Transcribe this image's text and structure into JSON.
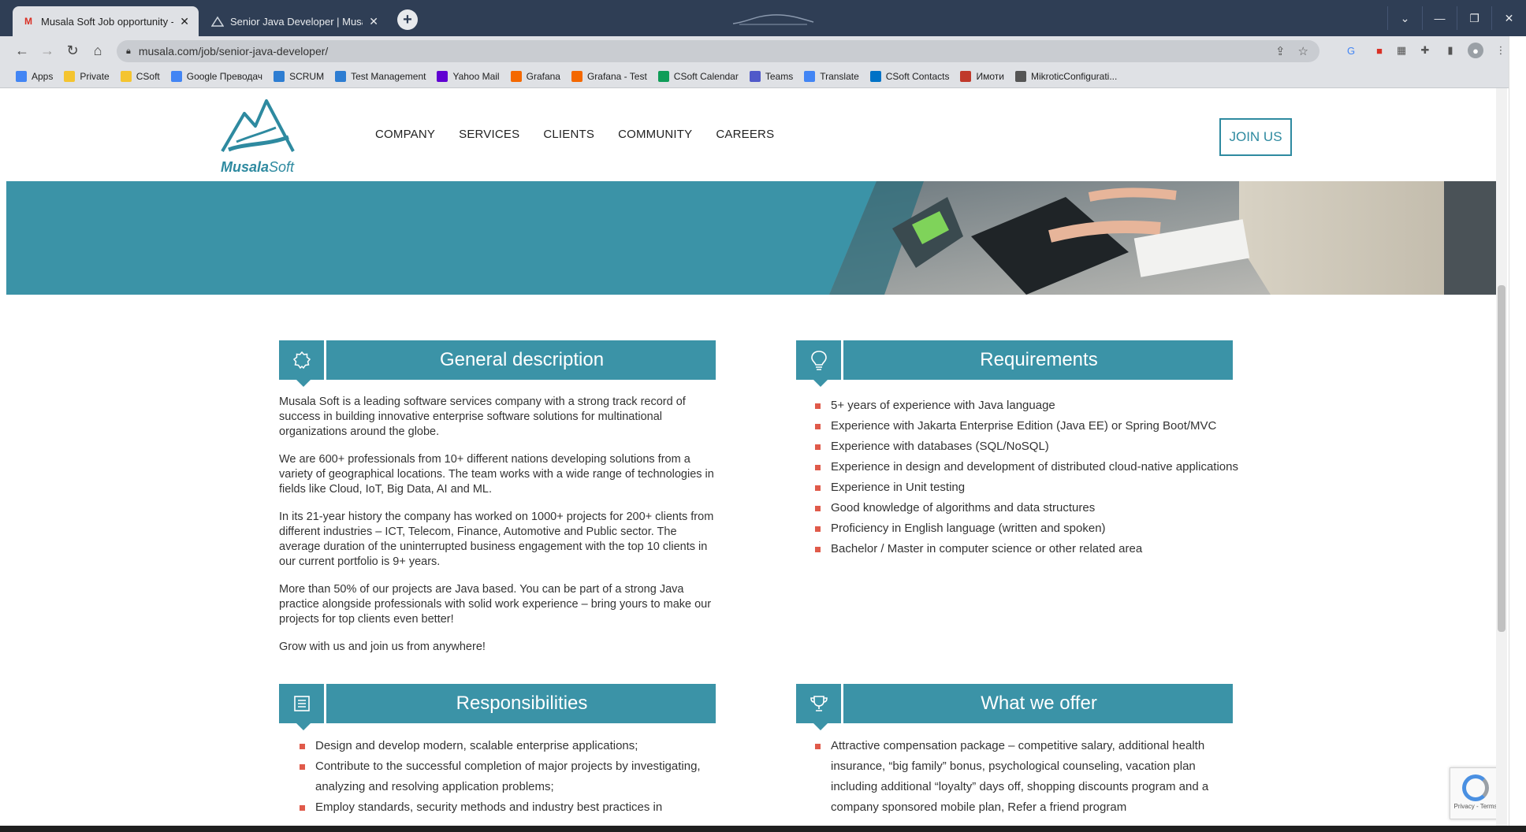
{
  "browser": {
    "tabs": [
      {
        "title": "Musala Soft Job opportunity - Au",
        "active": true
      },
      {
        "title": "Senior Java Developer | Musala S",
        "active": false
      }
    ],
    "new_tab_label": "+",
    "address": "musala.com/job/senior-java-developer/",
    "window_controls": {
      "collapse": "⌄",
      "minimize": "—",
      "restore": "❐",
      "close": "✕"
    }
  },
  "bookmarks": [
    {
      "label": "Apps",
      "color": "#4285f4"
    },
    {
      "label": "Private",
      "color": "#f4c430"
    },
    {
      "label": "CSoft",
      "color": "#f4c430"
    },
    {
      "label": "Google Преводач",
      "color": "#4285f4"
    },
    {
      "label": "SCRUM",
      "color": "#2d7dd2"
    },
    {
      "label": "Test Management",
      "color": "#2d7dd2"
    },
    {
      "label": "Yahoo Mail",
      "color": "#6001d2"
    },
    {
      "label": "Grafana",
      "color": "#f46800"
    },
    {
      "label": "Grafana - Test",
      "color": "#f46800"
    },
    {
      "label": "CSoft Calendar",
      "color": "#0f9d58"
    },
    {
      "label": "Teams",
      "color": "#5059c9"
    },
    {
      "label": "Translate",
      "color": "#4285f4"
    },
    {
      "label": "CSoft Contacts",
      "color": "#0072c6"
    },
    {
      "label": "Имоти",
      "color": "#c0392b"
    },
    {
      "label": "MikroticConfigurati...",
      "color": "#555555"
    }
  ],
  "site": {
    "logo": {
      "bold": "Musala",
      "light": "Soft"
    },
    "nav": [
      "COMPANY",
      "SERVICES",
      "CLIENTS",
      "COMMUNITY",
      "CAREERS"
    ],
    "join_label": "JOIN US"
  },
  "general": {
    "title": "General description",
    "paragraphs": [
      "Musala Soft is a leading software services company with a strong track record of success in building innovative enterprise software solutions for multinational organizations around the globe.",
      "We are 600+ professionals from 10+ different nations developing solutions from a variety of geographical locations. The team works with a wide range of technologies in fields like Cloud, IoT, Big Data, AI and ML.",
      "In its 21-year history the company has worked on 1000+ projects for 200+ clients from different industries  – ICT, Telecom, Finance, Automotive and Public sector. The average duration of the uninterrupted business engagement with the top 10 clients in our current portfolio is 9+ years.",
      "More than 50% of our projects are Java based. You can be part of a strong Java practice alongside professionals with solid work experience – bring yours to make our projects for top clients even better!",
      "Grow with us and join us from anywhere!"
    ]
  },
  "requirements": {
    "title": "Requirements",
    "items": [
      "5+ years of experience with Java language",
      "Experience with Jakarta Enterprise Edition (Java EE) or Spring Boot/MVC",
      "Experience with databases (SQL/NoSQL)",
      "Experience in design and development of distributed cloud-native applications",
      "Experience in Unit testing",
      "Good knowledge of algorithms and data structures",
      "Proficiency in English language (written and spoken)",
      "Bachelor / Master in computer science or other related area"
    ]
  },
  "responsibilities": {
    "title": "Responsibilities",
    "items": [
      "Design and develop modern, scalable enterprise applications;",
      "Contribute to the successful completion of major projects by investigating, analyzing and resolving application problems;",
      "Employ standards, security methods and industry best practices in"
    ]
  },
  "offer": {
    "title": "What we offer",
    "items": [
      "Attractive compensation package – competitive salary, additional health insurance, “big family” bonus, psychological counseling, vacation plan including additional “loyalty” days off, shopping discounts program and a company sponsored mobile plan, Refer a friend program"
    ]
  },
  "recaptcha": {
    "text": "Privacy - Terms"
  },
  "colors": {
    "brand": "#3b93a7",
    "bullet": "#e05a4a",
    "chrome": "#2f3e55"
  }
}
